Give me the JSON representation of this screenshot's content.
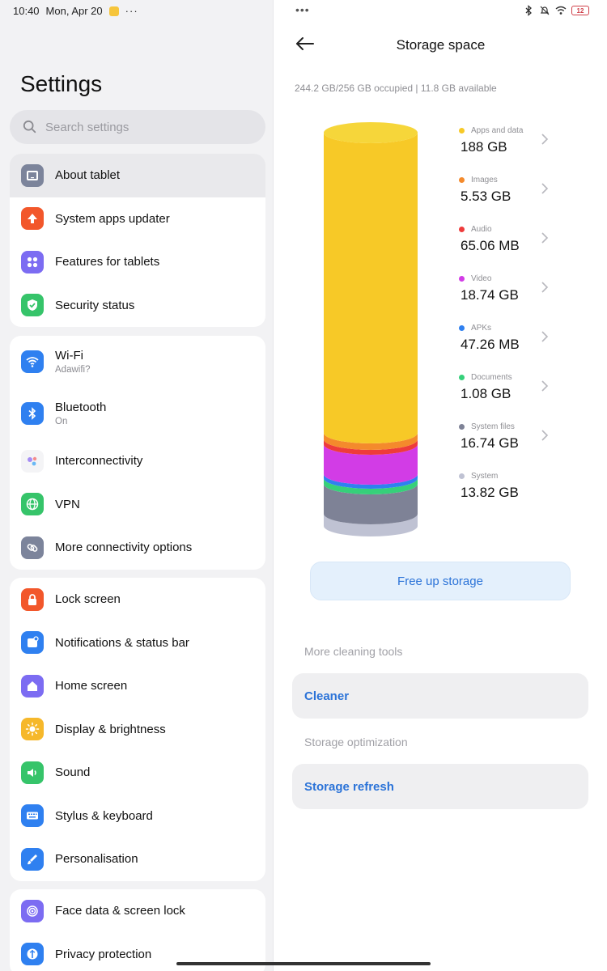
{
  "status_bar": {
    "time": "10:40",
    "date": "Mon, Apr 20",
    "more": "···",
    "battery": "12"
  },
  "settings": {
    "title": "Settings",
    "search_placeholder": "Search settings",
    "groups": [
      [
        {
          "label": "About tablet",
          "icon": "tablet-icon",
          "color": "#7c849b",
          "selected": true
        },
        {
          "label": "System apps updater",
          "icon": "arrow-up-icon",
          "color": "#f2572b"
        },
        {
          "label": "Features for tablets",
          "icon": "grid-icon",
          "color": "#7c6cf2"
        },
        {
          "label": "Security status",
          "icon": "shield-check-icon",
          "color": "#36c46a"
        }
      ],
      [
        {
          "label": "Wi-Fi",
          "sub": "Adawifi?",
          "icon": "wifi-icon",
          "color": "#2f80f0"
        },
        {
          "label": "Bluetooth",
          "sub": "On",
          "icon": "bluetooth-icon",
          "color": "#2f80f0"
        },
        {
          "label": "Interconnectivity",
          "icon": "interconnect-icon",
          "color": "#ffffff"
        },
        {
          "label": "VPN",
          "icon": "globe-icon",
          "color": "#36c46a"
        },
        {
          "label": "More connectivity options",
          "icon": "link-icon",
          "color": "#7c849b"
        }
      ],
      [
        {
          "label": "Lock screen",
          "icon": "lock-icon",
          "color": "#f2572b"
        },
        {
          "label": "Notifications & status bar",
          "icon": "notification-icon",
          "color": "#2f80f0"
        },
        {
          "label": "Home screen",
          "icon": "home-icon",
          "color": "#7c6cf2"
        },
        {
          "label": "Display & brightness",
          "icon": "sun-icon",
          "color": "#f6b82b"
        },
        {
          "label": "Sound",
          "icon": "speaker-icon",
          "color": "#36c46a"
        },
        {
          "label": "Stylus & keyboard",
          "icon": "keyboard-icon",
          "color": "#2f80f0"
        },
        {
          "label": "Personalisation",
          "icon": "brush-icon",
          "color": "#2f80f0"
        }
      ],
      [
        {
          "label": "Face data & screen lock",
          "icon": "face-icon",
          "color": "#7c6cf2"
        },
        {
          "label": "Privacy protection",
          "icon": "privacy-icon",
          "color": "#2f80f0"
        }
      ]
    ]
  },
  "storage": {
    "title": "Storage space",
    "summary": "244.2 GB/256 GB occupied | 11.8 GB available",
    "categories": [
      {
        "name": "Apps and data",
        "value": "188 GB",
        "color": "#f7c927",
        "chevron": true
      },
      {
        "name": "Images",
        "value": "5.53 GB",
        "color": "#f48a2c",
        "chevron": true
      },
      {
        "name": "Audio",
        "value": "65.06 MB",
        "color": "#ee3b3b",
        "chevron": true
      },
      {
        "name": "Video",
        "value": "18.74 GB",
        "color": "#d23ce6",
        "chevron": true
      },
      {
        "name": "APKs",
        "value": "47.26 MB",
        "color": "#2f80f0",
        "chevron": true
      },
      {
        "name": "Documents",
        "value": "1.08 GB",
        "color": "#36d07a",
        "chevron": true
      },
      {
        "name": "System files",
        "value": "16.74 GB",
        "color": "#7e8296",
        "chevron": true
      },
      {
        "name": "System",
        "value": "13.82 GB",
        "color": "#bfc2d3",
        "chevron": false
      }
    ],
    "free_button": "Free up storage",
    "sections": [
      {
        "label": "More cleaning tools",
        "tool": "Cleaner"
      },
      {
        "label": "Storage optimization",
        "tool": "Storage refresh"
      }
    ]
  }
}
